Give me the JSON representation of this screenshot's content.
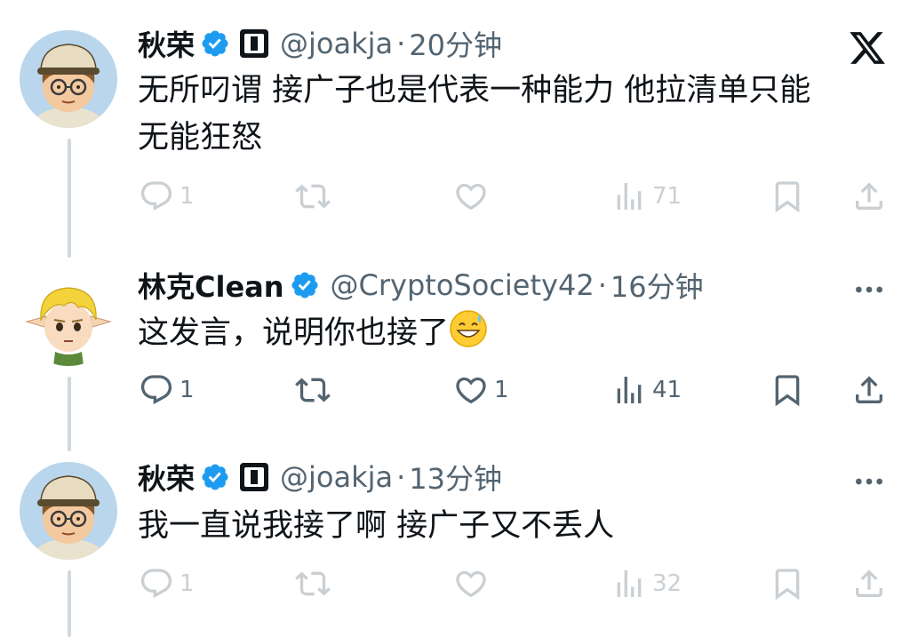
{
  "tweets": [
    {
      "name": "秋荣",
      "handle": "@joakja",
      "dot": "·",
      "time": "20分钟",
      "text_line1": "无所叼谓 接广子也是代表一种能力 他拉清单只能",
      "text_line2": "无能狂怒",
      "replies": "1",
      "retweets": "",
      "likes": "",
      "views": "71"
    },
    {
      "name": "林克Clean",
      "handle": "@CryptoSociety42",
      "dot": "·",
      "time": "16分钟",
      "text_line1": "这发言，说明你也接了",
      "replies": "1",
      "retweets": "",
      "likes": "1",
      "views": "41"
    },
    {
      "name": "秋荣",
      "handle": "@joakja",
      "dot": "·",
      "time": "13分钟",
      "text_line1": "我一直说我接了啊 接广子又不丢人",
      "replies": "1",
      "retweets": "",
      "likes": "",
      "views": "32"
    }
  ],
  "icons": {
    "avatar_cap_text": "MLADY",
    "brand": "x-logo",
    "verified": "verified-badge-icon",
    "emoji": "grinning-sweat-emoji"
  },
  "colors": {
    "verified_blue": "#1d9bf0",
    "muted": "#536471",
    "thread_line": "#cfd9de"
  }
}
